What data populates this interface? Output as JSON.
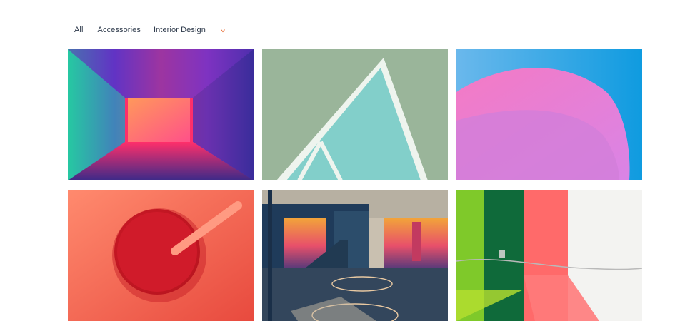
{
  "filters": {
    "items": [
      {
        "label": "All"
      },
      {
        "label": "Accessories"
      },
      {
        "label": "Interior Design"
      }
    ],
    "more_icon": "chevron-down-icon",
    "accent": "#e8703a"
  },
  "gallery": {
    "tiles": [
      {
        "subject": "neon-corridor"
      },
      {
        "subject": "teal-triangle-court"
      },
      {
        "subject": "pink-ribbon"
      },
      {
        "subject": "red-smoothie"
      },
      {
        "subject": "painted-basketball-court"
      },
      {
        "subject": "striped-wall"
      }
    ]
  }
}
